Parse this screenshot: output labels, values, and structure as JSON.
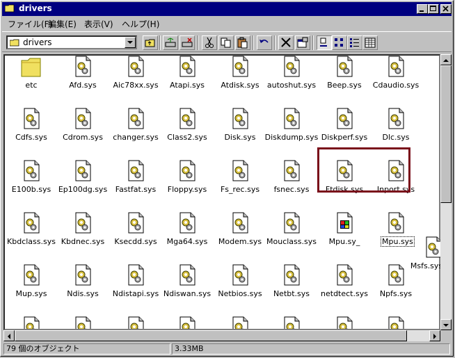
{
  "window": {
    "title": "drivers"
  },
  "menu": [
    "ファイル(F)",
    "編集(E)",
    "表示(V)",
    "ヘルプ(H)"
  ],
  "address": {
    "value": "drivers"
  },
  "status": {
    "objects": "79 個のオブジェクト",
    "size": "3.33MB"
  },
  "colors": {
    "titlebar": "#000080",
    "highlight": "#7a0e1a",
    "folder": "#f0e060"
  },
  "files": [
    [
      "etc",
      "Afd.sys",
      "Aic78xx.sys",
      "Atapi.sys",
      "Atdisk.sys",
      "autoshut.sys",
      "Beep.sys",
      "Cdaudio.sys"
    ],
    [
      "Cdfs.sys",
      "Cdrom.sys",
      "changer.sys",
      "Class2.sys",
      "Disk.sys",
      "Diskdump.sys",
      "Diskperf.sys",
      "Dlc.sys"
    ],
    [
      "E100b.sys",
      "Ep100dg.sys",
      "Fastfat.sys",
      "Floppy.sys",
      "Fs_rec.sys",
      "fsnec.sys",
      "Ftdisk.sys",
      "Inport.sys"
    ],
    [
      "Kbdclass.sys",
      "Kbdnec.sys",
      "Ksecdd.sys",
      "Mga64.sys",
      "Modem.sys",
      "Mouclass.sys",
      "Mpu.sy_",
      "Mpu.sys"
    ],
    [
      "Mup.sys",
      "Ndis.sys",
      "Ndistapi.sys",
      "Ndiswan.sys",
      "Netbios.sys",
      "Netbt.sys",
      "netdtect.sys",
      "Npfs.sys"
    ]
  ],
  "dragging_file": "Msfs.sys"
}
